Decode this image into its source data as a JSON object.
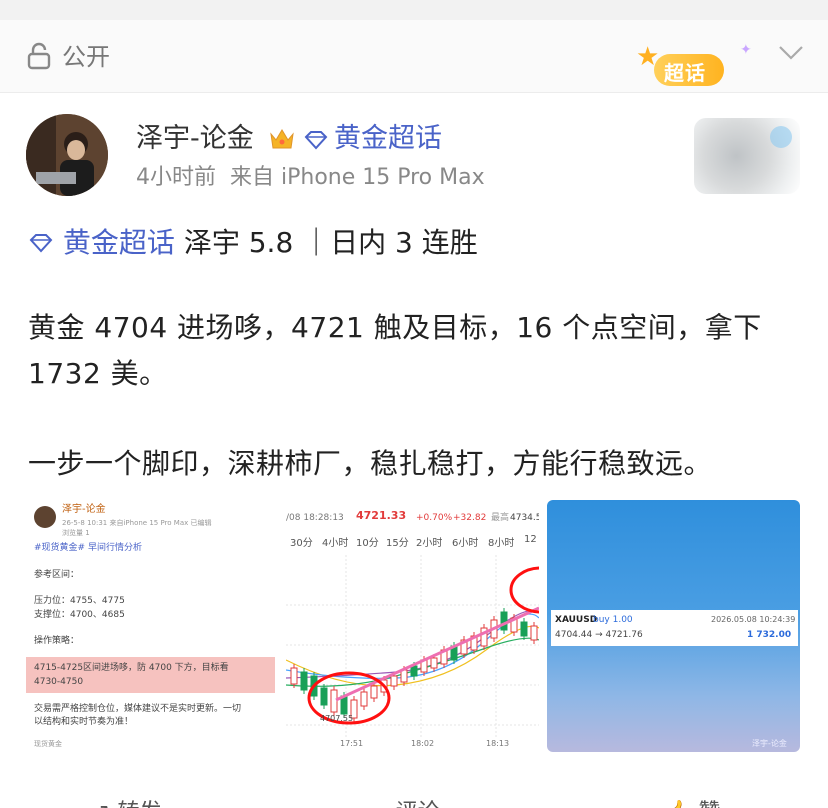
{
  "visibility": {
    "label": "公开",
    "lock_icon": "lock-icon"
  },
  "chaohua_badge": {
    "text": "超话"
  },
  "post": {
    "author": "泽宇-论金",
    "topic": "黄金超话",
    "time": "4小时前",
    "source": "来自 iPhone 15 Pro Max",
    "topic_tag": "黄金超话",
    "headline": "泽宇 5.8 ｜日内 3 连胜",
    "body_line1": "黄金 4704 进场哆，4721 触及目标，16 个点空间，拿下",
    "body_line2": "1732 美。",
    "body_line3": "一步一个脚印，深耕柿厂，稳扎稳打，方能行稳致远。"
  },
  "image1": {
    "author": "泽宇-论金",
    "meta": "26-5-8 10:31  来自iPhone 15 Pro Max  已编辑",
    "meta2": "浏览量 1",
    "tags": "#现货黄金# 早间行情分析",
    "ref_title": "参考区间：",
    "resistance": "压力位：4755、4775",
    "support": "支撑位：4700、4685",
    "strategy_title": "操作策略：",
    "strategy": "4715-4725区间进场哆，防 4700 下方，目标看",
    "strategy2": "4730-4750",
    "note": "交易需严格控制仓位，媒体建议不是实时更新。一切",
    "note2": "以结构和实时节奏为准！",
    "footer": "现货黄金"
  },
  "image2": {
    "date": "/08 18:28:13",
    "price": "4721.33",
    "change_pct": "+0.70%",
    "change_abs": "+32.82",
    "high_label": "最高",
    "high": "4734.5",
    "timeframes": [
      "30分",
      "4小时",
      "10分",
      "15分",
      "2小时",
      "6小时",
      "8小时",
      "12"
    ],
    "low_label": "4707.55",
    "x_ticks": [
      "17:51",
      "18:02",
      "18:13"
    ]
  },
  "image3": {
    "symbol": "XAUUSD",
    "side": "buy 1.00",
    "datetime": "2026.05.08 10:24:39",
    "prices": "4704.44 → 4721.76",
    "profit": "1 732.00",
    "watermark": "泽宇-论金"
  },
  "actions": {
    "forward": "转发",
    "comment": "评论",
    "like": "赞"
  },
  "colors": {
    "link": "#4a63c8",
    "up": "#e23b3b",
    "down": "#18a058",
    "highlight": "#f6c2bf"
  }
}
